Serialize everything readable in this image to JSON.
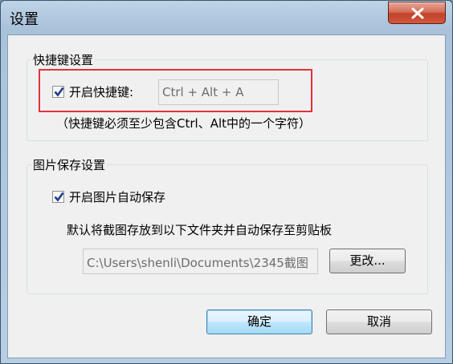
{
  "window": {
    "title": "设置",
    "close_icon": "close-x-icon"
  },
  "shortcut_group": {
    "title": "快捷键设置",
    "enable_label": "开启快捷键:",
    "enable_checked": true,
    "hotkey_value": "Ctrl + Alt + A",
    "hint": "（快捷键必须至少包含Ctrl、Alt中的一个字符）",
    "highlight_color": "#e0343a"
  },
  "image_group": {
    "title": "图片保存设置",
    "autosave_label": "开启图片自动保存",
    "autosave_checked": true,
    "description": "默认将截图存放到以下文件夹并自动保存至剪贴板",
    "folder_path": "C:\\Users\\shenli\\Documents\\2345截图",
    "change_button": "更改..."
  },
  "buttons": {
    "ok": "确定",
    "cancel": "取消"
  }
}
